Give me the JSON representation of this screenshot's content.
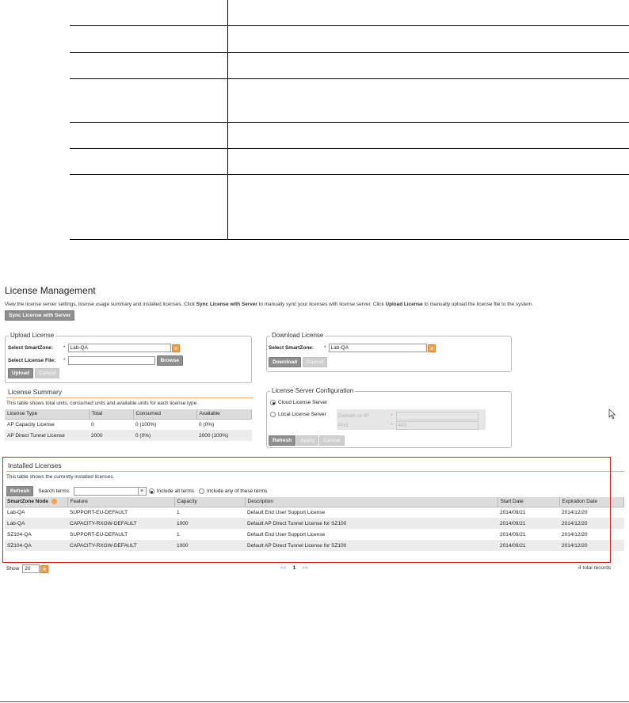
{
  "page": {
    "title": "License Management",
    "intro": {
      "part1": "View the license server settings, license usage summary and installed licenses. Click ",
      "bold1": "Sync License with Server",
      "part2": " to manually sync your licenses with license server. Click ",
      "bold2": "Upload License",
      "part3": " to manually upload the license file to the system."
    },
    "sync_button": "Sync License with Server"
  },
  "upload_license": {
    "legend": "Upload License",
    "smartzone_label": "Select SmartZone:",
    "smartzone_value": "Lab-QA",
    "file_label": "Select License File:",
    "file_value": "",
    "browse_button": "Browse",
    "upload_button": "Upload",
    "cancel_button": "Cancel"
  },
  "download_license": {
    "legend": "Download License",
    "smartzone_label": "Select SmartZone:",
    "smartzone_value": "Lab-QA",
    "download_button": "Download",
    "cancel_button": "Cancel"
  },
  "license_summary": {
    "title": "License Summary",
    "description": "This table shows total units, consumed units and available units for each license type.",
    "columns": [
      "License Type",
      "Total",
      "Consumed",
      "Available"
    ],
    "rows": [
      [
        "AP Capacity License",
        "0",
        "0 (100%)",
        "0 (0%)"
      ],
      [
        "AP Direct Tunnel License",
        "2000",
        "0 (0%)",
        "2000 (100%)"
      ]
    ]
  },
  "license_server_config": {
    "legend": "License Server Configuration",
    "cloud_option": "Cloud License Server",
    "local_option": "Local License Server",
    "domain_label": "Domain or IP:",
    "port_label": "Port:",
    "port_value": "443",
    "refresh_button": "Refresh",
    "apply_button": "Apply",
    "cancel_button": "Cancel"
  },
  "installed_licenses": {
    "title": "Installed Licenses",
    "description": "This table shows the currently installed licenses.",
    "refresh_button": "Refresh",
    "search_label": "Search terms:",
    "search_value": "",
    "include_all": "Include all terms",
    "include_any": "Include any of these terms",
    "columns": [
      "SmartZone Node",
      "Feature",
      "Capacity",
      "Description",
      "Start Date",
      "Expiration Date"
    ],
    "rows": [
      [
        "Lab-QA",
        "SUPPORT-EU-DEFAULT",
        "1",
        "Default End User Support License",
        "2014/09/21",
        "2014/12/20"
      ],
      [
        "Lab-QA",
        "CAPACITY-RXGW-DEFAULT",
        "1000",
        "Default AP Direct Tunnel License for SZ100",
        "2014/09/21",
        "2014/12/20"
      ],
      [
        "SZ104-QA",
        "SUPPORT-EU-DEFAULT",
        "1",
        "Default End User Support License",
        "2014/09/21",
        "2014/12/20"
      ],
      [
        "SZ104-QA",
        "CAPACITY-RXGW-DEFAULT",
        "1000",
        "Default AP Direct Tunnel License for SZ100",
        "2014/09/21",
        "2014/12/20"
      ]
    ],
    "show_label": "Show",
    "page_size": "20",
    "prev": "<<",
    "current_page": "1",
    "next": ">>",
    "total_records": "4 total records"
  },
  "colors": {
    "accent_orange": "#f7a24a",
    "highlight_red": "#e0201d",
    "button_gray": "#8f8f8f"
  }
}
